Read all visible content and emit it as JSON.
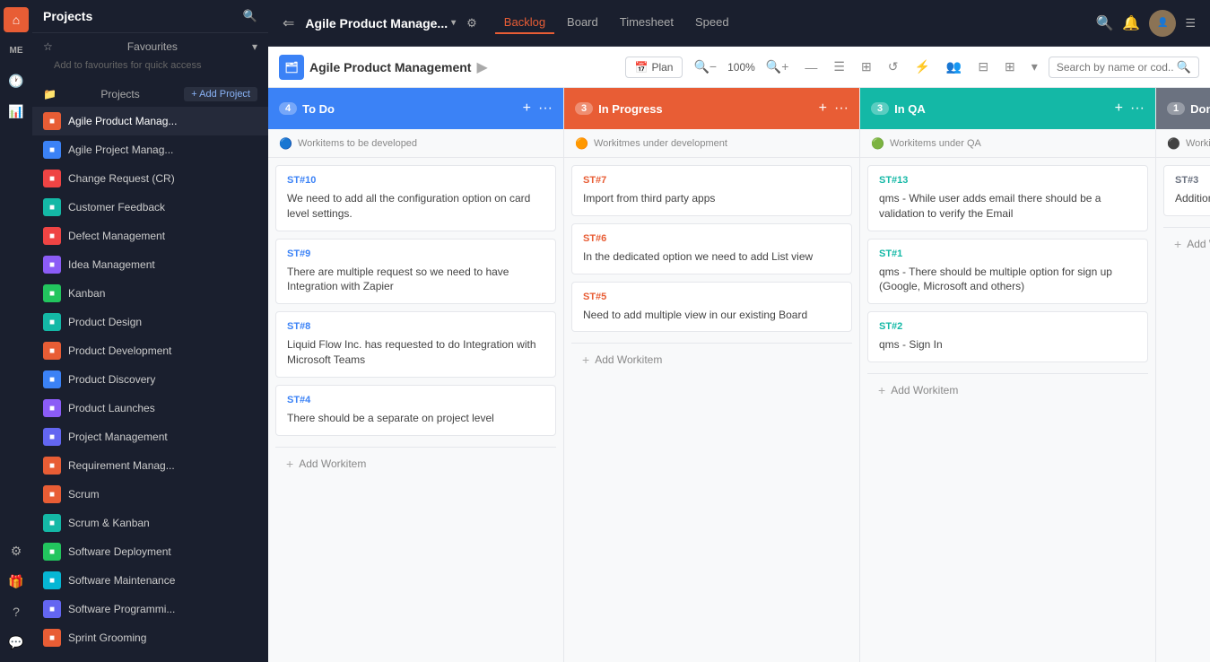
{
  "iconRail": {
    "icons": [
      {
        "name": "home-icon",
        "symbol": "⌂",
        "active": true
      },
      {
        "name": "me-icon",
        "symbol": "ME",
        "active": false
      },
      {
        "name": "clock-icon",
        "symbol": "🕐",
        "active": false
      },
      {
        "name": "chart-icon",
        "symbol": "📊",
        "active": false
      },
      {
        "name": "settings-icon",
        "symbol": "⚙",
        "active": false
      },
      {
        "name": "gift-icon",
        "symbol": "🎁",
        "active": false
      },
      {
        "name": "help-icon",
        "symbol": "?",
        "active": false
      },
      {
        "name": "chat-icon",
        "symbol": "💬",
        "active": false
      }
    ]
  },
  "sidebar": {
    "title": "Projects",
    "favourites": {
      "label": "Favourites",
      "addText": "Add to favourites for quick access"
    },
    "projectsLabel": "Projects",
    "addProjectLabel": "+ Add Project",
    "items": [
      {
        "id": "agile-manage",
        "label": "Agile Product Manag...",
        "color": "pi-orange",
        "active": true
      },
      {
        "id": "agile-project",
        "label": "Agile Project Manag...",
        "color": "pi-blue"
      },
      {
        "id": "change-request",
        "label": "Change Request (CR)",
        "color": "pi-red"
      },
      {
        "id": "customer-feedback",
        "label": "Customer Feedback",
        "color": "pi-teal"
      },
      {
        "id": "defect-management",
        "label": "Defect Management",
        "color": "pi-red"
      },
      {
        "id": "idea-management",
        "label": "Idea Management",
        "color": "pi-purple"
      },
      {
        "id": "kanban",
        "label": "Kanban",
        "color": "pi-green"
      },
      {
        "id": "product-design",
        "label": "Product Design",
        "color": "pi-teal"
      },
      {
        "id": "product-development",
        "label": "Product Development",
        "color": "pi-orange"
      },
      {
        "id": "product-discovery",
        "label": "Product Discovery",
        "color": "pi-blue"
      },
      {
        "id": "product-launches",
        "label": "Product Launches",
        "color": "pi-purple"
      },
      {
        "id": "project-management",
        "label": "Project Management",
        "color": "pi-indigo"
      },
      {
        "id": "requirement",
        "label": "Requirement Manag...",
        "color": "pi-orange"
      },
      {
        "id": "scrum",
        "label": "Scrum",
        "color": "pi-orange"
      },
      {
        "id": "scrum-kanban",
        "label": "Scrum & Kanban",
        "color": "pi-teal"
      },
      {
        "id": "software-deployment",
        "label": "Software Deployment",
        "color": "pi-green"
      },
      {
        "id": "software-maintenance",
        "label": "Software Maintenance",
        "color": "pi-cyan"
      },
      {
        "id": "software-programmi",
        "label": "Software Programmi...",
        "color": "pi-indigo"
      },
      {
        "id": "sprint-grooming",
        "label": "Sprint Grooming",
        "color": "pi-orange"
      }
    ]
  },
  "topNav": {
    "backLabel": "≡",
    "title": "Agile Product Manage...",
    "chevron": "▾",
    "tabs": [
      {
        "id": "backlog",
        "label": "Backlog",
        "active": true
      },
      {
        "id": "board",
        "label": "Board"
      },
      {
        "id": "timesheet",
        "label": "Timesheet"
      },
      {
        "id": "speed",
        "label": "Speed"
      }
    ],
    "hamburger": "☰"
  },
  "toolbar": {
    "projectLabel": "Agile Product Management",
    "planButton": "Plan",
    "zoomLevel": "100%",
    "searchPlaceholder": "Search by name or cod..."
  },
  "board": {
    "columns": [
      {
        "id": "todo",
        "title": "To Do",
        "count": 4,
        "colorClass": "col-todo",
        "idClass": "todo-id",
        "description": "Workitems to be developed",
        "cards": [
          {
            "id": "ST#10",
            "text": "We need to add all the configuration option on card level settings."
          },
          {
            "id": "ST#9",
            "text": "There are multiple request so we need to have Integration with Zapier"
          },
          {
            "id": "ST#8",
            "text": "Liquid Flow Inc. has requested to do Integration with Microsoft Teams"
          },
          {
            "id": "ST#4",
            "text": "There should be a separate on project level"
          }
        ],
        "addLabel": "Add Workitem"
      },
      {
        "id": "inprogress",
        "title": "In Progress",
        "count": 3,
        "colorClass": "col-inprogress",
        "idClass": "progress-id",
        "description": "Workitmes under development",
        "cards": [
          {
            "id": "ST#7",
            "text": "Import from third party apps"
          },
          {
            "id": "ST#6",
            "text": "In the dedicated option we need to add List view"
          },
          {
            "id": "ST#5",
            "text": "Need to add multiple view in our existing Board"
          }
        ],
        "addLabel": "Add Workitem"
      },
      {
        "id": "inqa",
        "title": "In QA",
        "count": 3,
        "colorClass": "col-inqa",
        "idClass": "qa-id",
        "description": "Workitems under QA",
        "cards": [
          {
            "id": "ST#13",
            "text": "qms - While user adds email there should be a validation to verify the Email"
          },
          {
            "id": "ST#1",
            "text": "qms - There should be multiple option for sign up (Google, Microsoft and others)"
          },
          {
            "id": "ST#2",
            "text": "qms - Sign In"
          }
        ],
        "addLabel": "Add Workitem"
      },
      {
        "id": "done",
        "title": "Done",
        "count": 1,
        "colorClass": "col-done",
        "idClass": "done-id",
        "description": "Worki...",
        "cards": [
          {
            "id": "ST#3",
            "text": "Additional C..."
          }
        ],
        "addLabel": "Add Workitem"
      }
    ]
  }
}
